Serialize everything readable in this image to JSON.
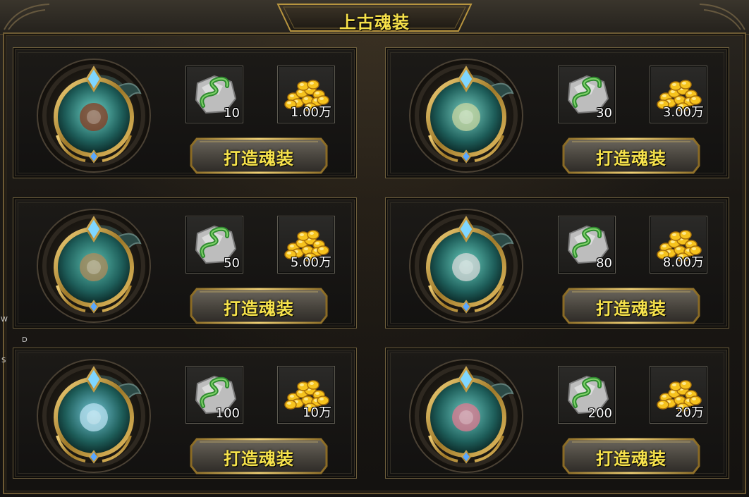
{
  "window": {
    "title": "上古魂装"
  },
  "side_keys": [
    "W",
    "D",
    "S"
  ],
  "colors": {
    "title": "#f5e04a",
    "button_text": "#f7e34c",
    "frame_gold": "#c9a24a",
    "gem_teal": "#2aa8a0"
  },
  "recipes": [
    {
      "material_icon": "dragon-ore-icon",
      "material_count": "10",
      "currency_icon": "gold-coins-icon",
      "gold_cost": "1.00万",
      "action_label": "打造魂装",
      "soul_icon": "eye-soul-icon"
    },
    {
      "material_icon": "dragon-ore-icon",
      "material_count": "30",
      "currency_icon": "gold-coins-icon",
      "gold_cost": "3.00万",
      "action_label": "打造魂装",
      "soul_icon": "spider-soul-icon"
    },
    {
      "material_icon": "dragon-ore-icon",
      "material_count": "50",
      "currency_icon": "gold-coins-icon",
      "gold_cost": "5.00万",
      "action_label": "打造魂装",
      "soul_icon": "nest-soul-icon"
    },
    {
      "material_icon": "dragon-ore-icon",
      "material_count": "80",
      "currency_icon": "gold-coins-icon",
      "gold_cost": "8.00万",
      "action_label": "打造魂装",
      "soul_icon": "skull-soul-icon"
    },
    {
      "material_icon": "dragon-ore-icon",
      "material_count": "100",
      "currency_icon": "gold-coins-icon",
      "gold_cost": "10万",
      "action_label": "打造魂装",
      "soul_icon": "blue-flower-soul-icon"
    },
    {
      "material_icon": "dragon-ore-icon",
      "material_count": "200",
      "currency_icon": "gold-coins-icon",
      "gold_cost": "20万",
      "action_label": "打造魂装",
      "soul_icon": "pink-flower-soul-icon"
    }
  ]
}
